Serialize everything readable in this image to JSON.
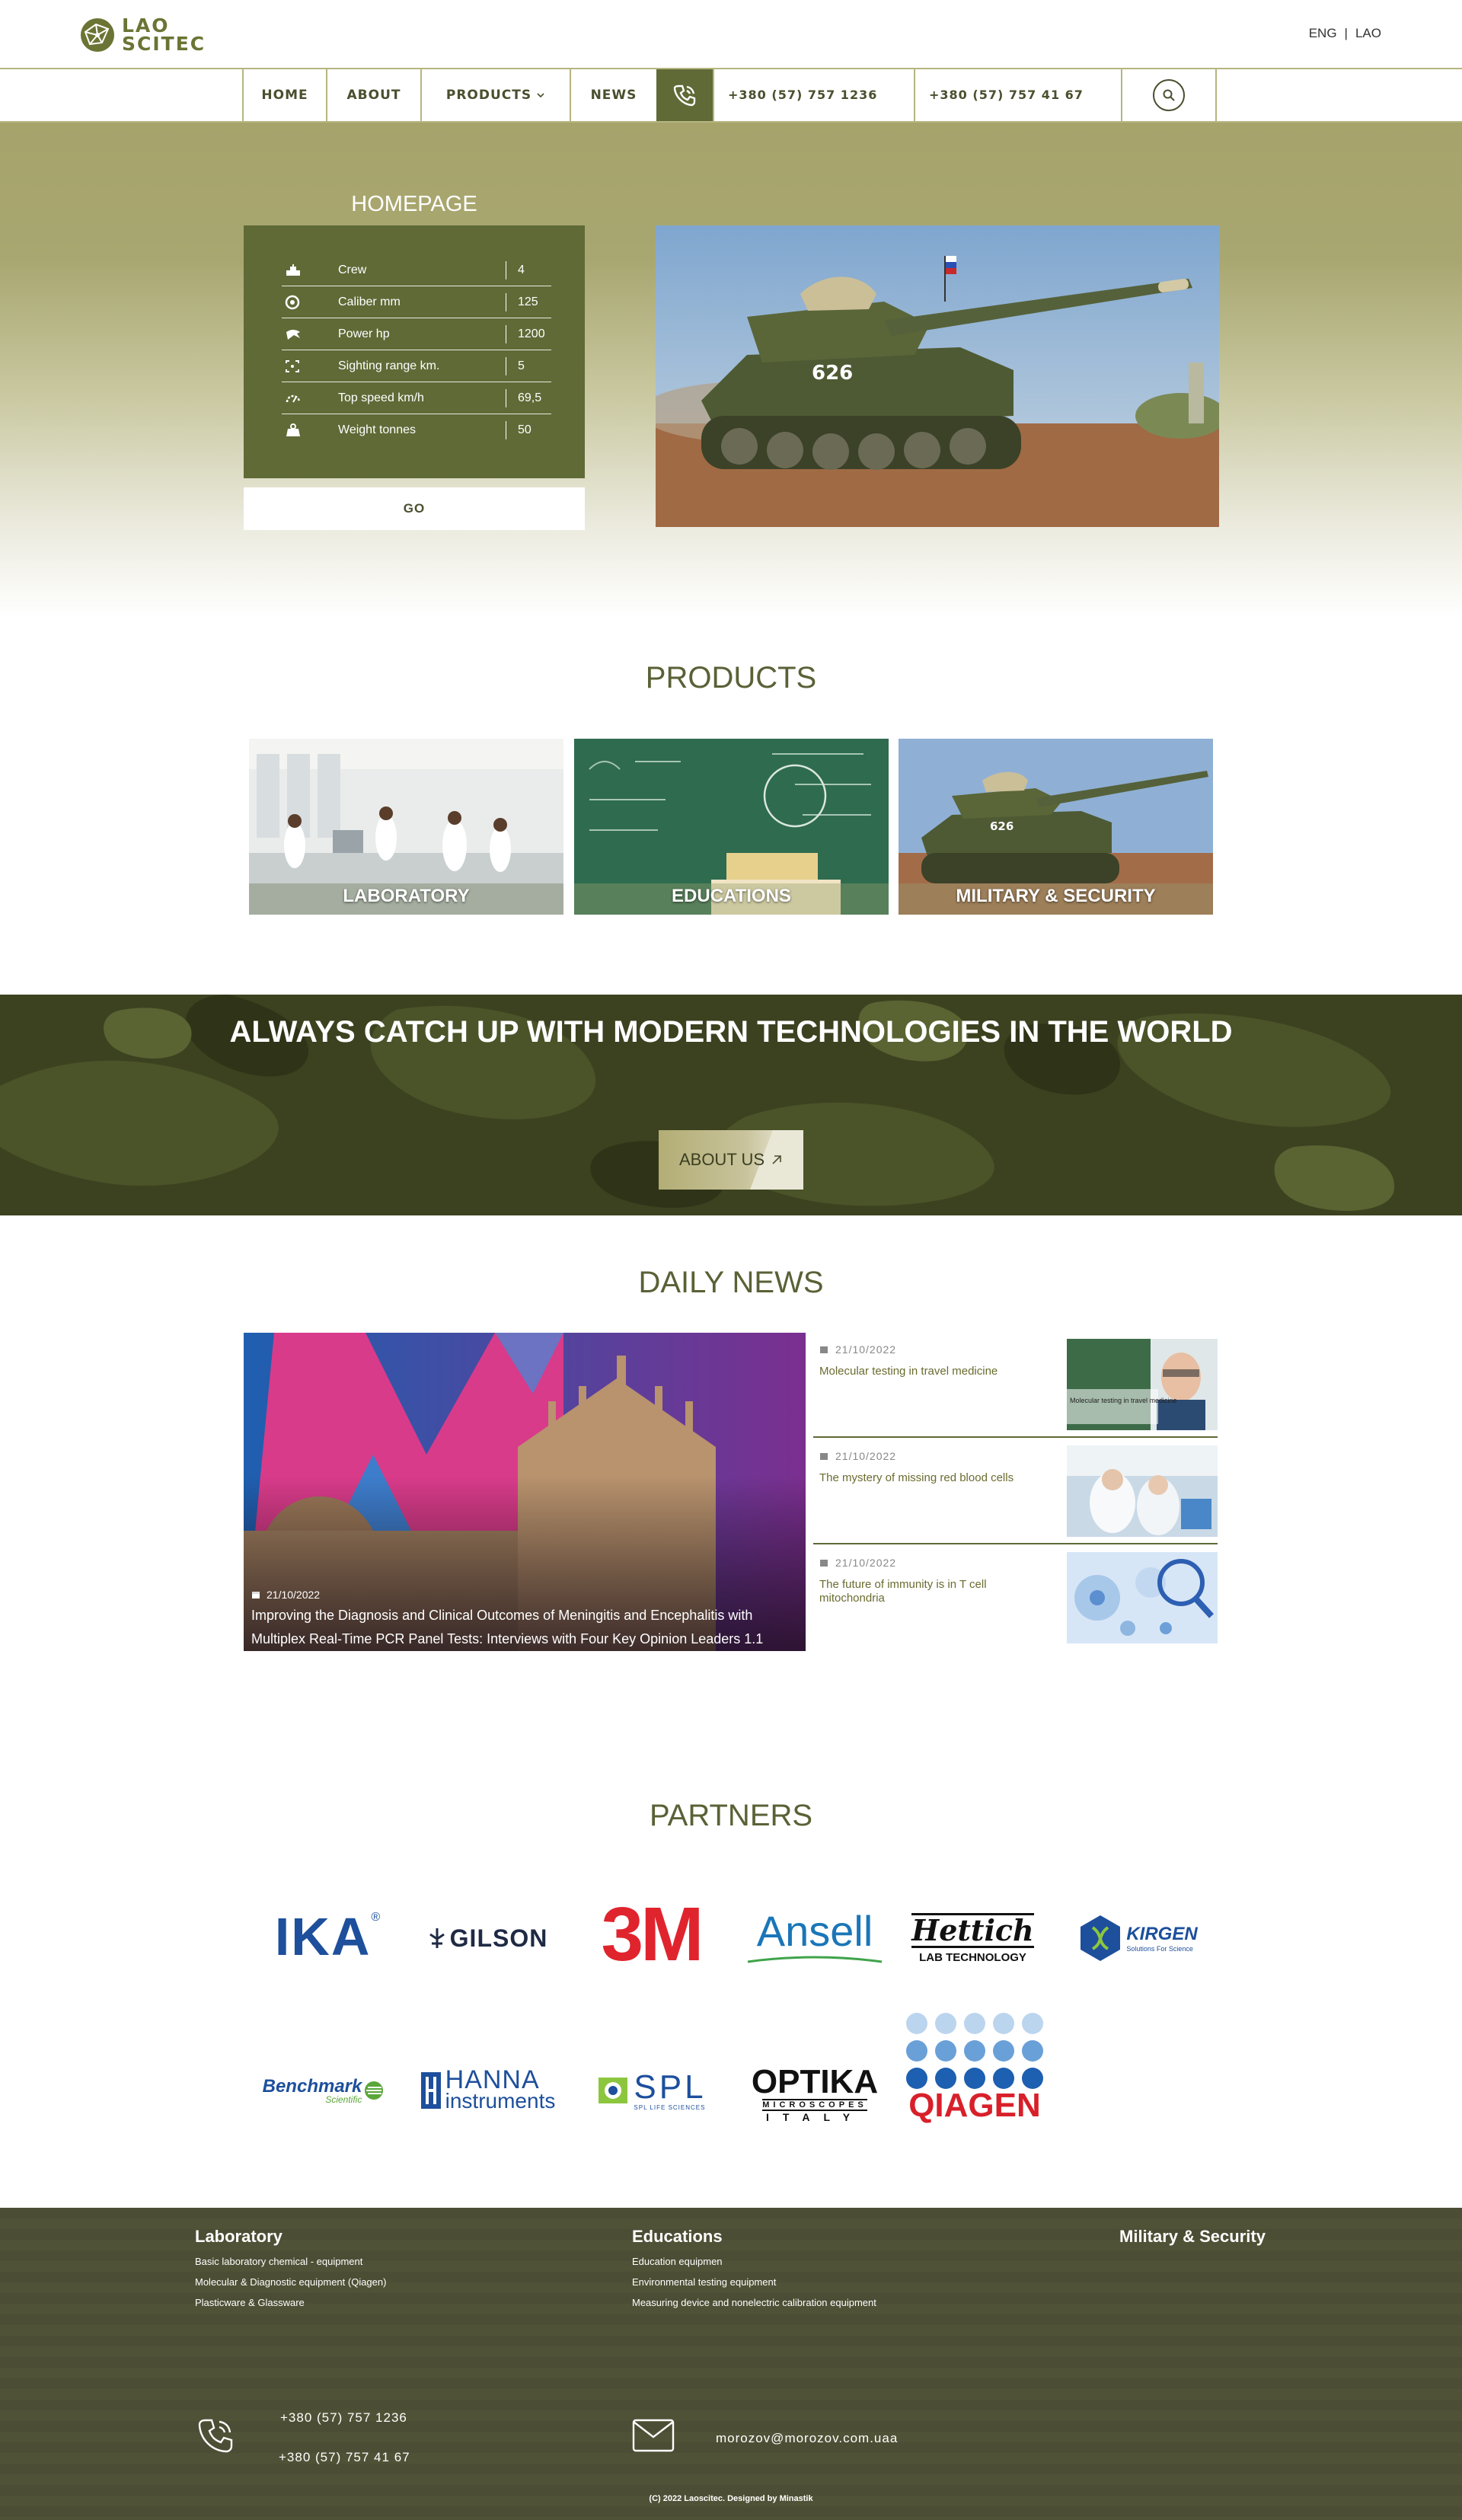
{
  "brand": {
    "name_line1": "LAO",
    "name_line2": "SCITEC",
    "colors": {
      "primary": "#5f6a36",
      "accent": "#a6a46b",
      "footer": "#4b4e34"
    }
  },
  "languages": [
    "ENG",
    "LAO"
  ],
  "nav": {
    "items": [
      "HOME",
      "ABOUT",
      "PRODUCTS",
      "NEWS"
    ],
    "phone1": "+380 (57) 757 1236",
    "phone2": "+380 (57) 757 41 67",
    "phone_icon": "phone-icon",
    "search_icon": "search-icon"
  },
  "hero": {
    "title": "HOMEPAGE",
    "specs": [
      {
        "icon": "crew-icon",
        "label": "Crew",
        "value": "4"
      },
      {
        "icon": "caliber-icon",
        "label": "Caliber mm",
        "value": "125"
      },
      {
        "icon": "power-icon",
        "label": "Power hp",
        "value": "1200"
      },
      {
        "icon": "sight-icon",
        "label": "Sighting range km.",
        "value": "5"
      },
      {
        "icon": "speed-icon",
        "label": "Top speed km/h",
        "value": "69,5"
      },
      {
        "icon": "weight-icon",
        "label": "Weight tonnes",
        "value": "50"
      }
    ],
    "go_label": "GO",
    "tank_number": "626"
  },
  "products": {
    "title": "PRODUCTS",
    "cards": [
      {
        "label": "LABORATORY"
      },
      {
        "label": "EDUCATIONS"
      },
      {
        "label": "MILITARY & SECURITY"
      }
    ]
  },
  "banner": {
    "title": "ALWAYS CATCH UP WITH MODERN TECHNOLOGIES IN THE WORLD",
    "button": "ABOUT US"
  },
  "news": {
    "title": "DAILY NEWS",
    "main": {
      "date": "21/10/2022",
      "title": "Improving the Diagnosis and Clinical Outcomes of Meningitis and Encephalitis with Multiplex Real-Time PCR Panel Tests: Interviews with Four Key Opinion Leaders 1.1"
    },
    "items": [
      {
        "date": "21/10/2022",
        "title": "Molecular testing in travel medicine",
        "thumb_caption": "Molecular testing in travel medicine"
      },
      {
        "date": "21/10/2022",
        "title": "The mystery of missing red blood cells"
      },
      {
        "date": "21/10/2022",
        "title": "The future of immunity is in T cell mitochondria"
      }
    ]
  },
  "partners": {
    "title": "PARTNERS",
    "logos": {
      "ika": "IKA",
      "gilson": "GILSON",
      "3m": "3M",
      "ansell": "Ansell",
      "hettich": "Hettich",
      "hettich_sub": "LAB TECHNOLOGY",
      "kirgen": "KIRGEN",
      "kirgen_sub": "Solutions For Science",
      "benchmark": "Benchmark",
      "benchmark_sub": "Scientific",
      "hanna": "HANNA",
      "hanna_sub": "instruments",
      "spl": "SPL",
      "spl_sub": "SPL LIFE SCIENCES",
      "optika": "OPTIKA",
      "optika_sub1": "MICROSCOPES",
      "optika_sub2": "ITALY",
      "qiagen": "QIAGEN"
    }
  },
  "footer": {
    "columns": [
      {
        "title": "Laboratory",
        "links": [
          "Basic laboratory chemical - equipment",
          "Molecular & Diagnostic equipment (Qiagen)",
          "Plasticware & Glassware"
        ]
      },
      {
        "title": "Educations",
        "links": [
          "Education equipmen",
          "Environmental testing equipment",
          "Measuring device and nonelectric calibration equipment"
        ]
      },
      {
        "title": "Military & Security",
        "links": []
      }
    ],
    "phone1": "+380 (57) 757 1236",
    "phone2": "+380 (57) 757 41 67",
    "email": "morozov@morozov.com.uaa",
    "copyright": "(C) 2022 Laoscitec. Designed by Minastik"
  }
}
